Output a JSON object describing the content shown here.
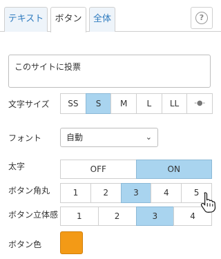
{
  "tabs": [
    {
      "label": "テキスト",
      "active": false
    },
    {
      "label": "ボタン",
      "active": true
    },
    {
      "label": "全体",
      "active": false
    }
  ],
  "help_icon": "question-circle-icon",
  "text_field": {
    "value": "このサイトに投票"
  },
  "font_size": {
    "label": "文字サイズ",
    "options": [
      "SS",
      "S",
      "M",
      "L",
      "LL",
      "-●-"
    ],
    "selected": "S"
  },
  "font": {
    "label": "フォント",
    "value": "自動"
  },
  "bold": {
    "label": "太字",
    "options": [
      "OFF",
      "ON"
    ],
    "selected": "ON"
  },
  "corner_radius": {
    "label": "ボタン角丸",
    "options": [
      "1",
      "2",
      "3",
      "4",
      "5"
    ],
    "selected": "3"
  },
  "depth": {
    "label": "ボタン立体感",
    "options": [
      "1",
      "2",
      "3",
      "4"
    ],
    "selected": "3"
  },
  "button_color": {
    "label": "ボタン色",
    "value": "#f39a16"
  },
  "colors": {
    "accent_tab_text": "#2f7bbf",
    "selected_bg": "#a9d4ef"
  }
}
